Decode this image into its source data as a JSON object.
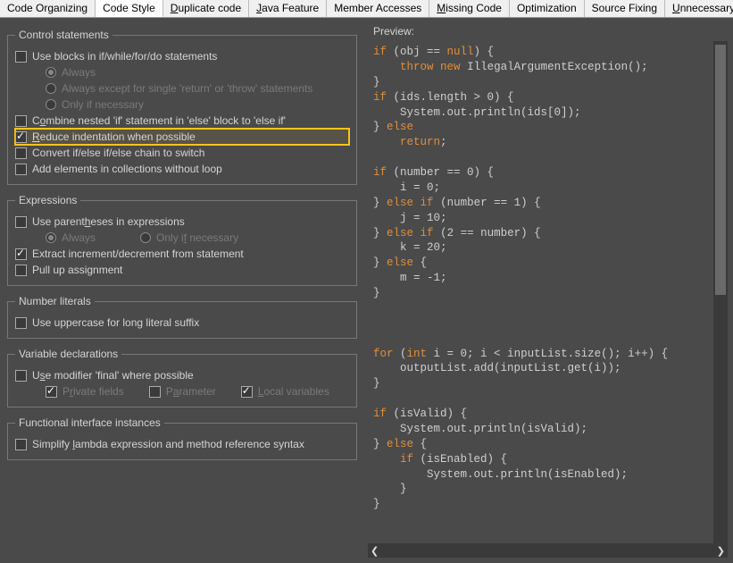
{
  "tabs": [
    {
      "label": "Code Organizing",
      "mnemonic": ""
    },
    {
      "label": "Code Style",
      "mnemonic": "",
      "active": true
    },
    {
      "label": "Duplicate code",
      "mnemonic": "D"
    },
    {
      "label": "Java Feature",
      "mnemonic": "J"
    },
    {
      "label": "Member Accesses",
      "mnemonic": ""
    },
    {
      "label": "Missing Code",
      "mnemonic": "M"
    },
    {
      "label": "Optimization",
      "mnemonic": ""
    },
    {
      "label": "Source Fixing",
      "mnemonic": ""
    },
    {
      "label": "Unnecessary Code",
      "mnemonic": "U"
    }
  ],
  "groups": {
    "control": {
      "legend": "Control statements",
      "useBlocks": {
        "label": "Use blocks in if/while/for/do statements",
        "checked": false
      },
      "r1": "Always",
      "r2": "Always except for single 'return' or 'throw' statements",
      "r3": "Only if necessary",
      "combine": {
        "label_pre": "C",
        "label_u": "o",
        "label_post": "mbine nested 'if' statement in 'else' block to 'else if'",
        "checked": false
      },
      "reduce": {
        "label_pre": "",
        "label_u": "R",
        "label_post": "educe indentation when possible",
        "checked": true
      },
      "convert": {
        "label": "Convert if/else if/else chain to switch",
        "checked": false
      },
      "addElems": {
        "label": "Add elements in collections without loop",
        "checked": false
      }
    },
    "expr": {
      "legend": "Expressions",
      "paren": {
        "label_pre": "Use parent",
        "label_u": "h",
        "label_post": "eses in expressions",
        "checked": false
      },
      "r1": "Always",
      "r2_pre": "Only i",
      "r2_u": "f",
      "r2_post": " necessary",
      "extract": {
        "label": "Extract increment/decrement from statement",
        "checked": true
      },
      "pull": {
        "label": "Pull up assignment",
        "checked": false
      }
    },
    "num": {
      "legend": "Number literals",
      "upper": {
        "label": "Use uppercase for long literal suffix",
        "checked": false
      }
    },
    "vars": {
      "legend": "Variable declarations",
      "final": {
        "label_pre": "U",
        "label_u": "s",
        "label_post": "e modifier 'final' where possible",
        "checked": false
      },
      "c1_pre": "P",
      "c1_u": "r",
      "c1_post": "ivate fields",
      "c2_pre": "P",
      "c2_u": "a",
      "c2_post": "rameter",
      "c3_pre": "",
      "c3_u": "L",
      "c3_post": "ocal variables"
    },
    "func": {
      "legend": "Functional interface instances",
      "simplify": {
        "label_pre": "Simplify ",
        "label_u": "l",
        "label_post": "ambda expression and method reference syntax",
        "checked": false
      }
    }
  },
  "preview": {
    "label": "Preview:",
    "code_html": "<span class=\"kw\">if</span> (obj == <span class=\"kw\">null</span>) {\n    <span class=\"kw\">throw</span> <span class=\"kw\">new</span> IllegalArgumentException();\n}\n<span class=\"kw\">if</span> (ids.length &gt; 0) {\n    System.out.println(ids[0]);\n} <span class=\"kw\">else</span>\n    <span class=\"kw\">return</span>;\n\n<span class=\"kw\">if</span> (number == 0) {\n    i = 0;\n} <span class=\"kw\">else</span> <span class=\"kw\">if</span> (number == 1) {\n    j = 10;\n} <span class=\"kw\">else</span> <span class=\"kw\">if</span> (2 == number) {\n    k = 20;\n} <span class=\"kw\">else</span> {\n    m = -1;\n}\n\n\n\n<span class=\"kw\">for</span> (<span class=\"kw\">int</span> i = 0; i &lt; inputList.size(); i++) {\n    outputList.add(inputList.get(i));\n}\n\n<span class=\"kw\">if</span> (isValid) {\n    System.out.println(isValid);\n} <span class=\"kw\">else</span> {\n    <span class=\"kw\">if</span> (isEnabled) {\n        System.out.println(isEnabled);\n    }\n}"
  }
}
